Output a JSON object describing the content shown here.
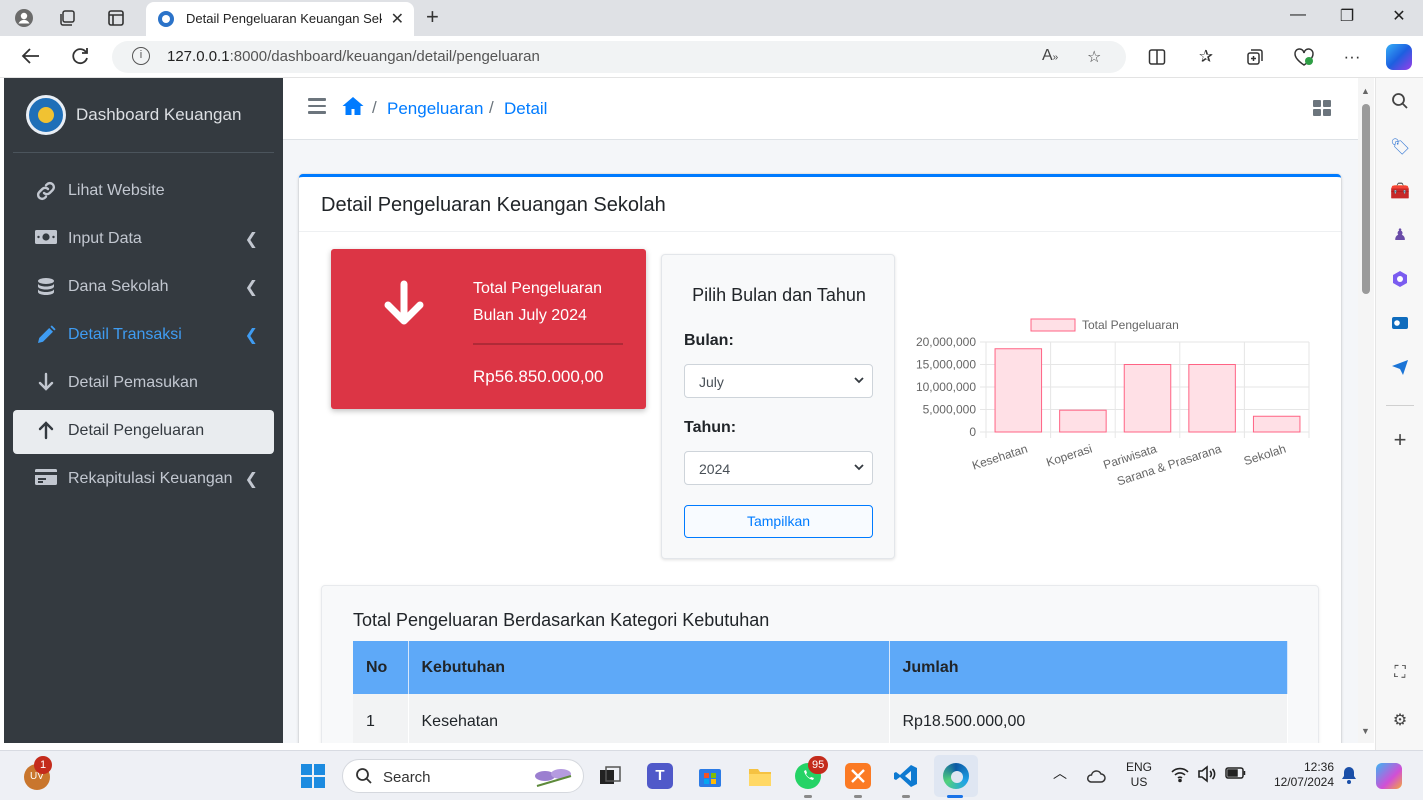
{
  "browser": {
    "tab_title": "Detail Pengeluaran Keuangan Sekolah",
    "url_host": "127.0.0.1",
    "url_path": ":8000/dashboard/keuangan/detail/pengeluaran"
  },
  "sidebar": {
    "brand": "Dashboard Keuangan",
    "items": [
      {
        "label": "Lihat Website",
        "icon": "link-icon"
      },
      {
        "label": "Input Data",
        "icon": "money-bill-icon"
      },
      {
        "label": "Dana Sekolah",
        "icon": "coins-icon"
      },
      {
        "label": "Detail Transaksi",
        "icon": "pencil-icon"
      },
      {
        "label": "Detail Pemasukan",
        "icon": "arrow-down-icon"
      },
      {
        "label": "Detail Pengeluaran",
        "icon": "arrow-up-icon"
      },
      {
        "label": "Rekapitulasi Keuangan",
        "icon": "id-card-icon"
      }
    ]
  },
  "breadcrumb": {
    "items": [
      "Pengeluaran",
      "Detail"
    ]
  },
  "card": {
    "title": "Detail Pengeluaran Keuangan Sekolah"
  },
  "summary": {
    "title_line1": "Total Pengeluaran",
    "title_line2": "Bulan July 2024",
    "value": "Rp56.850.000,00",
    "color": "#dc3545"
  },
  "picker": {
    "title": "Pilih Bulan dan Tahun",
    "month_label": "Bulan:",
    "month_value": "July",
    "year_label": "Tahun:",
    "year_value": "2024",
    "button": "Tampilkan"
  },
  "chart_data": {
    "type": "bar",
    "categories": [
      "Kesehatan",
      "Koperasi",
      "Pariwisata",
      "Sarana & Prasarana",
      "Sekolah"
    ],
    "series": [
      {
        "name": "Total Pengeluaran",
        "values": [
          18500000,
          4850000,
          15000000,
          15000000,
          3500000
        ]
      }
    ],
    "ylim": [
      0,
      20000000
    ],
    "yticks": [
      "20,000,000",
      "15,000,000",
      "10,000,000",
      "5,000,000",
      "0"
    ],
    "legend": "top",
    "bar_color": "#ffe0e6",
    "bar_border": "#ff6384",
    "grid": true
  },
  "table": {
    "title": "Total Pengeluaran Berdasarkan Kategori Kebutuhan",
    "headers": [
      "No",
      "Kebutuhan",
      "Jumlah"
    ],
    "rows": [
      [
        "1",
        "Kesehatan",
        "Rp18.500.000,00"
      ]
    ]
  },
  "taskbar": {
    "search_placeholder": "Search",
    "language": "ENG",
    "region": "US",
    "time": "12:36",
    "date": "12/07/2024",
    "whatsapp_badge": "95",
    "notification_badge": "1",
    "user_initials": "UV"
  }
}
